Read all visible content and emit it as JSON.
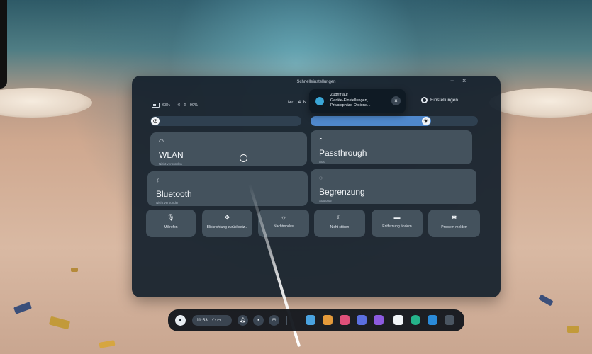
{
  "panel": {
    "title": "Schnelleinstellungen",
    "minimize": "−",
    "close": "×",
    "battery_headset": "63%",
    "battery_controller": "90%",
    "date": "Mo., 4. N",
    "settings_label": "Einstellungen"
  },
  "toast": {
    "text_line1": "Zugriff auf",
    "text_line2": "Geräte-Einstellungen,",
    "text_line3": "Privatsphäre-Optione..."
  },
  "sliders": {
    "volume_fraction": 0.0,
    "brightness_fraction": 0.72
  },
  "tiles": {
    "wlan": {
      "title": "WLAN",
      "subtitle": "Nicht verbunden"
    },
    "passthrough": {
      "title": "Passthrough",
      "subtitle": "Aus"
    },
    "bluetooth": {
      "title": "Bluetooth",
      "subtitle": "Nicht verbunden"
    },
    "boundary": {
      "title": "Begrenzung",
      "subtitle": "Stationär"
    }
  },
  "quick_buttons": {
    "mic": "Mikrofon",
    "recenter": "Blickrichtung zurücksetz...",
    "night": "Nachtmodus",
    "dnd": "Nicht stören",
    "distance": "Entfernung ändern",
    "report": "Problem melden"
  },
  "taskbar": {
    "time": "11:53"
  },
  "colors": {
    "panel_bg": "#16222e",
    "tile_bg": "#485662",
    "accent": "#4f88cc"
  }
}
